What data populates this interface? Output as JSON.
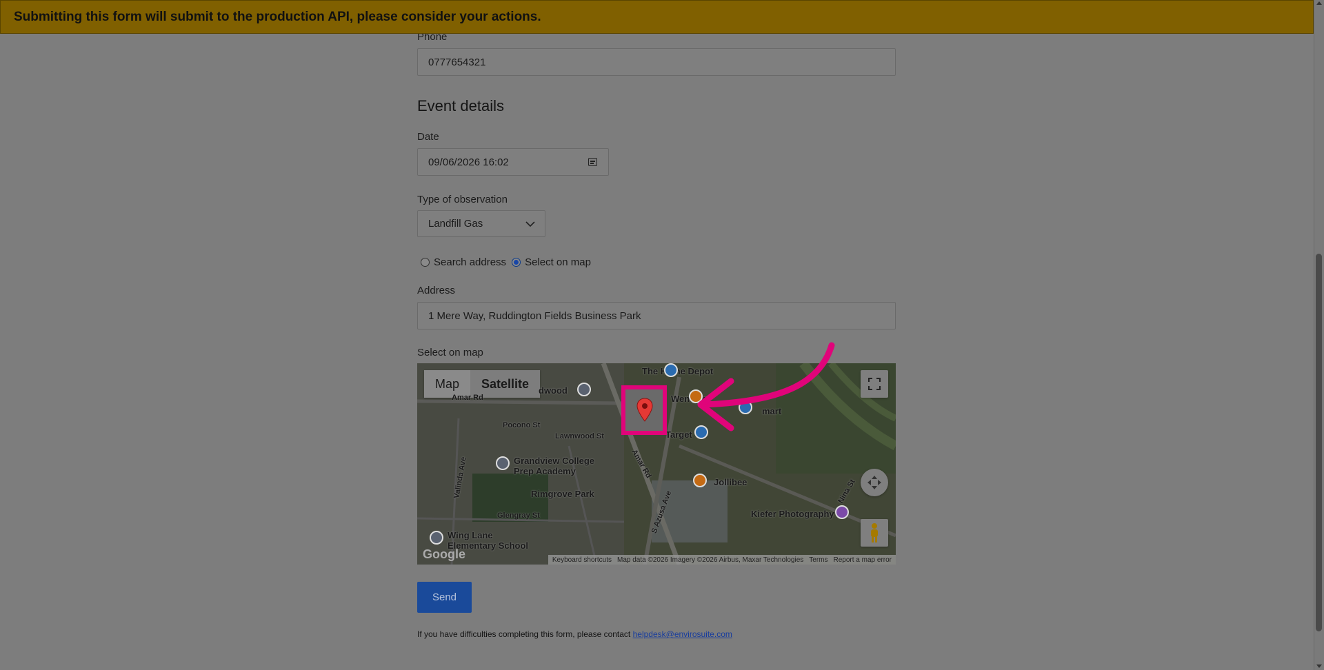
{
  "banner": {
    "text": "Submitting this form will submit to the production API, please consider your actions."
  },
  "form": {
    "phone_label": "Phone",
    "phone_value": "0777654321",
    "section_title": "Event details",
    "date_label": "Date",
    "date_value": "09/06/2026 16:02",
    "observation_label": "Type of observation",
    "observation_value": "Landfill Gas",
    "radio_search_label": "Search address",
    "radio_map_label": "Select on map",
    "radio_selected": "Select on map",
    "address_label": "Address",
    "address_value": "1 Mere Way, Ruddington Fields Business Park",
    "select_map_label": "Select on map"
  },
  "map": {
    "tab_map": "Map",
    "tab_satellite": "Satellite",
    "active_tab": "Satellite",
    "labels": {
      "home_depot": "The Home Depot",
      "wendys": "Wendy's",
      "target": "Target",
      "mart": "mart",
      "jollibee": "Jollibee",
      "kiefer": "Kiefer Photography",
      "grandview": "Grandview College",
      "prep": "Prep Academy",
      "rimgrove": "Rimgrove Park",
      "wing_lane": "Wing Lane",
      "elementary": "Elementary School",
      "pocono": "Pocono St",
      "lawnwood": "Lawnwood St",
      "amar_rd": "Amar Rd",
      "amar_rd_2": "Amar Rd",
      "glengray": "Glengray St",
      "valinda": "Valinda Ave",
      "azusa": "S Azusa Ave",
      "nina": "Nina St",
      "wood": "dwood",
      "google": "Google"
    },
    "attribution": {
      "shortcuts": "Keyboard shortcuts",
      "data": "Map data ©2026 Imagery ©2026 Airbus, Maxar Technologies",
      "terms": "Terms",
      "report": "Report a map error"
    },
    "colors": {
      "highlight": "#e0047a",
      "pin": "#e53935"
    }
  },
  "send_label": "Send",
  "footer": {
    "text": "If you have difficulties completing this form, please contact ",
    "email": "helpdesk@envirosuite.com"
  }
}
